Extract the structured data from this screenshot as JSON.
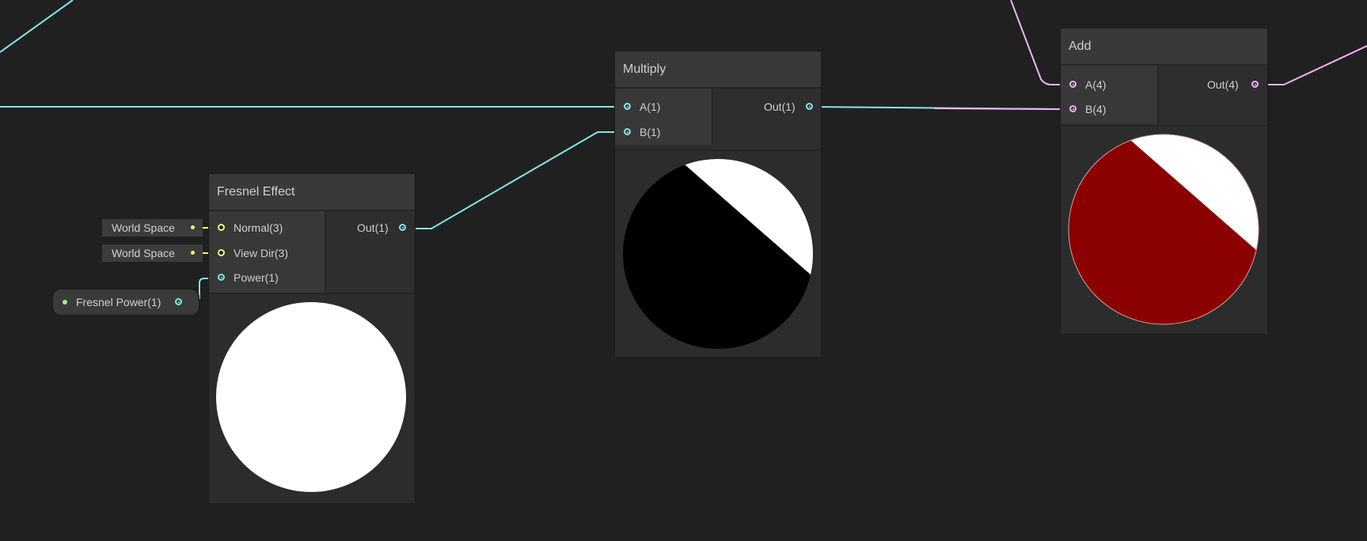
{
  "colors": {
    "background": "#202020",
    "float_wire": "#84e4e7",
    "vector4_wire": "#f1b1f7",
    "vector3_wire": "#f3f37e",
    "property_dot": "#9cf08a",
    "add_preview_dark": "#8b0000"
  },
  "nodes": {
    "fresnel": {
      "title": "Fresnel Effect",
      "inputs": [
        "Normal(3)",
        "View Dir(3)",
        "Power(1)"
      ],
      "output": "Out(1)",
      "normal_default": "World Space",
      "viewdir_default": "World Space"
    },
    "multiply": {
      "title": "Multiply",
      "inputs": [
        "A(1)",
        "B(1)"
      ],
      "output": "Out(1)"
    },
    "add": {
      "title": "Add",
      "inputs": [
        "A(4)",
        "B(4)"
      ],
      "output": "Out(4)"
    },
    "property": {
      "label": "Fresnel Power(1)"
    }
  },
  "icons": {
    "port": "circle-port-icon",
    "property": "property-dot-icon"
  }
}
